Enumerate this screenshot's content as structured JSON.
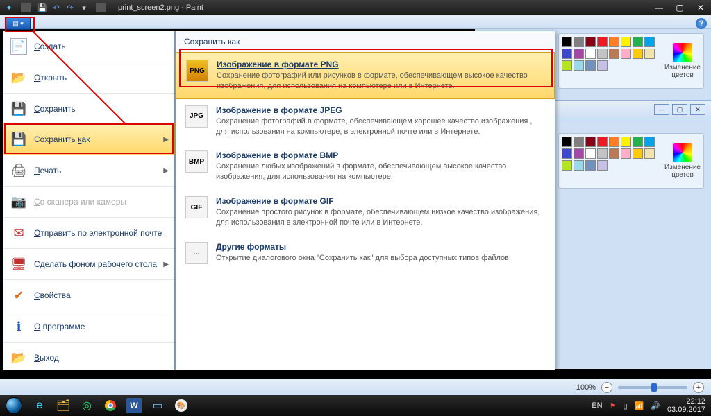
{
  "window": {
    "title": "print_screen2.png - Paint"
  },
  "filemenu": {
    "items": [
      {
        "label": "Создать",
        "icon": "new"
      },
      {
        "label": "Открыть",
        "icon": "open"
      },
      {
        "label": "Сохранить",
        "icon": "save"
      },
      {
        "label": "Сохранить как",
        "icon": "saveas",
        "hasArrow": true,
        "highlight": true
      },
      {
        "label": "Печать",
        "icon": "print",
        "hasArrow": true
      },
      {
        "label": "Со сканера или камеры",
        "icon": "scan",
        "disabled": true
      },
      {
        "label": "Отправить по электронной почте",
        "icon": "mail"
      },
      {
        "label": "Сделать фоном рабочего стола",
        "icon": "desk",
        "hasArrow": true
      },
      {
        "label": "Свойства",
        "icon": "prop"
      },
      {
        "label": "О программе",
        "icon": "about"
      },
      {
        "label": "Выход",
        "icon": "exit"
      }
    ]
  },
  "submenu": {
    "header": "Сохранить как",
    "items": [
      {
        "title": "Изображение в формате PNG",
        "desc": "Сохранение фотографий или рисунков в формате, обеспечивающем высокое качество изображения, для использования на компьютере или в Интернете.",
        "icon": "PNG",
        "highlight": true,
        "under": true
      },
      {
        "title": "Изображение в формате JPEG",
        "desc": "Сохранение фотографий в формате, обеспечивающем хорошее качество изображения , для использования на компьютере, в электронной почте или в Интернете.",
        "icon": "JPG"
      },
      {
        "title": "Изображение в формате BMP",
        "desc": "Сохранение любых изображений в формате, обеспечивающем высокое качество изображения, для использования на компьютере.",
        "icon": "BMP"
      },
      {
        "title": "Изображение в формате GIF",
        "desc": "Сохранение простого рисунок в формате, обеспечивающем низкое качество изображения, для использования в электронной почте или в Интернете.",
        "icon": "GIF"
      },
      {
        "title": "Другие форматы",
        "desc": "Открытие диалогового окна \"Сохранить как\" для выбора доступных типов файлов.",
        "icon": "…"
      }
    ]
  },
  "colors": {
    "label": "Изменение цветов",
    "row1": [
      "#000000",
      "#7f7f7f",
      "#880015",
      "#ed1c24",
      "#ff7f27",
      "#fff200",
      "#22b14c",
      "#00a2e8",
      "#3f48cc",
      "#a349a4"
    ],
    "row2": [
      "#ffffff",
      "#c3c3c3",
      "#b97a57",
      "#ffaec9",
      "#ffc90e",
      "#efe4b0",
      "#b5e61d",
      "#99d9ea",
      "#7092be",
      "#c8bfe7"
    ]
  },
  "status": {
    "zoom": "100%"
  },
  "tray": {
    "lang": "EN",
    "time": "22:12",
    "date": "03.09.2017"
  }
}
